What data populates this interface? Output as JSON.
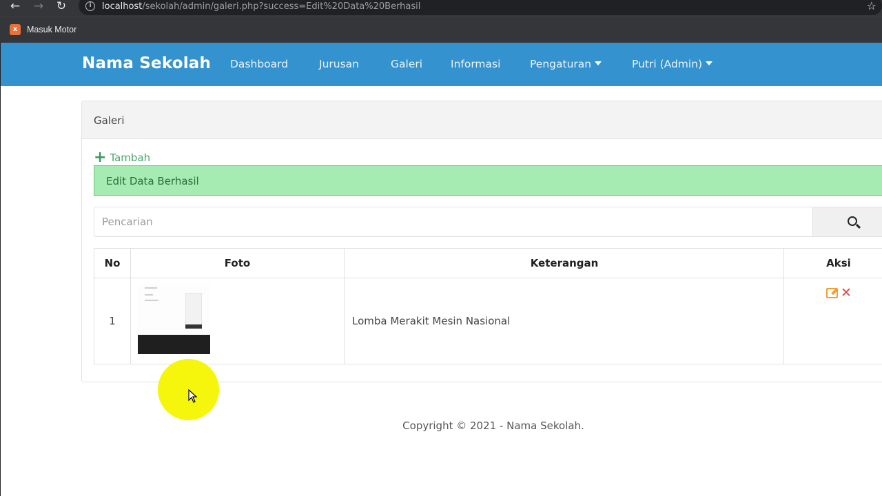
{
  "browser": {
    "url_host": "localhost",
    "url_path": "/sekolah/admin/galeri.php?success=Edit%20Data%20Berhasil",
    "bookmark_label": "Masuk Motor"
  },
  "navbar": {
    "brand": "Nama Sekolah",
    "links": [
      "Dashboard",
      "Jurusan",
      "Galeri",
      "Informasi",
      "Pengaturan",
      "Putri (Admin)"
    ],
    "color": "#3492cf"
  },
  "panel": {
    "title": "Galeri",
    "add_label": "Tambah",
    "alert": "Edit Data Berhasil",
    "search_placeholder": "Pencarian"
  },
  "table": {
    "headers": [
      "No",
      "Foto",
      "Keterangan",
      "Aksi"
    ],
    "rows": [
      {
        "no": "1",
        "keterangan": "Lomba Merakit Mesin Nasional"
      }
    ]
  },
  "footer": {
    "copyright": "Copyright © 2021 - Nama Sekolah."
  }
}
